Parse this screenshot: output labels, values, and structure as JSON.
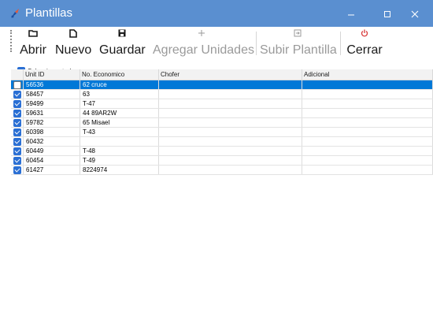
{
  "window": {
    "title": "Plantillas"
  },
  "toolbar": {
    "abrir": {
      "label": "Abrir",
      "icon": "folder-icon"
    },
    "nuevo": {
      "label": "Nuevo",
      "icon": "new-file-icon"
    },
    "guardar": {
      "label": "Guardar",
      "icon": "save-icon"
    },
    "agregar": {
      "label": "Agregar Unidades",
      "icon": "plus-icon"
    },
    "subir": {
      "label": "Subir Plantilla",
      "icon": "import-icon"
    },
    "cerrar": {
      "label": "Cerrar",
      "icon": "power-icon"
    }
  },
  "select_all": {
    "label": "Seleccionar todo",
    "checked": true
  },
  "table": {
    "columns": [
      "Unit ID",
      "No. Economico",
      "Chofer",
      "Adicional"
    ],
    "rows": [
      {
        "checked": false,
        "selected": true,
        "unit_id": "56536",
        "no_economico": "62 cruce",
        "chofer": "",
        "adicional": ""
      },
      {
        "checked": true,
        "selected": false,
        "unit_id": "58457",
        "no_economico": "63",
        "chofer": "",
        "adicional": ""
      },
      {
        "checked": true,
        "selected": false,
        "unit_id": "59499",
        "no_economico": "T-47",
        "chofer": "",
        "adicional": ""
      },
      {
        "checked": true,
        "selected": false,
        "unit_id": "59631",
        "no_economico": "44 89AR2W",
        "chofer": "",
        "adicional": ""
      },
      {
        "checked": true,
        "selected": false,
        "unit_id": "59782",
        "no_economico": "65 Misael",
        "chofer": "",
        "adicional": ""
      },
      {
        "checked": true,
        "selected": false,
        "unit_id": "60398",
        "no_economico": "T-43",
        "chofer": "",
        "adicional": ""
      },
      {
        "checked": true,
        "selected": false,
        "unit_id": "60432",
        "no_economico": "",
        "chofer": "",
        "adicional": ""
      },
      {
        "checked": true,
        "selected": false,
        "unit_id": "60449",
        "no_economico": "T-48",
        "chofer": "",
        "adicional": ""
      },
      {
        "checked": true,
        "selected": false,
        "unit_id": "60454",
        "no_economico": "T-49",
        "chofer": "",
        "adicional": ""
      },
      {
        "checked": true,
        "selected": false,
        "unit_id": "61427",
        "no_economico": "8224974",
        "chofer": "",
        "adicional": ""
      }
    ]
  },
  "colors": {
    "titlebar": "#5a8fd0",
    "selection": "#0078d7",
    "checkbox": "#2a6fd4",
    "close_icon": "#d83b3b"
  }
}
